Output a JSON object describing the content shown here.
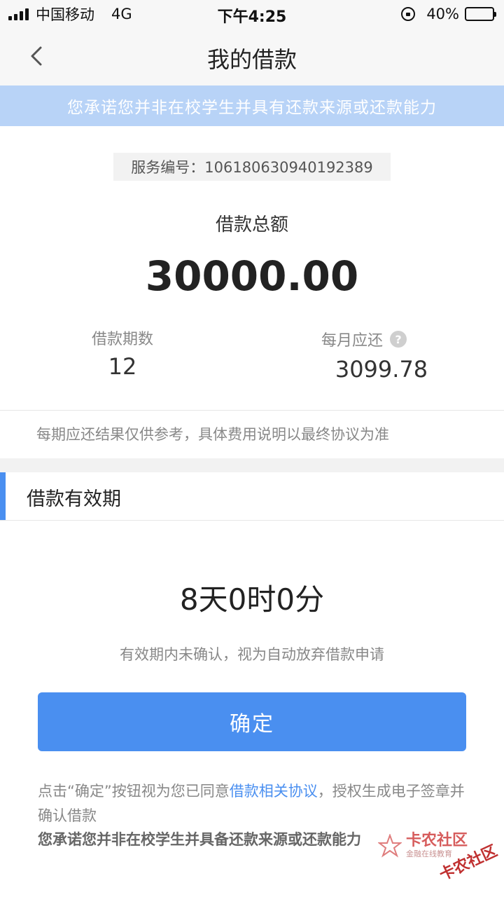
{
  "status_bar": {
    "carrier": "中国移动",
    "network": "4G",
    "time": "下午4:25",
    "battery_pct": "40%",
    "battery_level": 0.4
  },
  "nav": {
    "title": "我的借款",
    "back_icon": "chevron-left-icon"
  },
  "banner": {
    "text": "您承诺您并非在校学生并具有还款来源或还款能力"
  },
  "loan": {
    "serial": "服务编号：106180630940192389",
    "total_label": "借款总额",
    "total_amount": "30000.00",
    "term_label": "借款期数",
    "term_value": "12",
    "monthly_label": "每月应还",
    "monthly_value": "3099.78",
    "help_icon": "question-circle-icon",
    "note": "每期应还结果仅供参考，具体费用说明以最终协议为准"
  },
  "validity": {
    "section_title": "借款有效期",
    "countdown": "8天0时0分",
    "note": "有效期内未确认，视为自动放弃借款申请"
  },
  "actions": {
    "confirm_label": "确定"
  },
  "agreement": {
    "prefix": "点击“确定”按钮视为您已同意",
    "link": "借款相关协议",
    "suffix": "，授权生成电子签章并确认借款",
    "pledge": "您承诺您并非在校学生并具备还款来源或还款能力"
  },
  "watermark": {
    "main": "卡农社区",
    "sub": "金融在线教育",
    "second": "卡农社区"
  },
  "colors": {
    "accent": "#4a8ff0",
    "banner": "#b8d3f7",
    "gray_text": "#888888"
  }
}
